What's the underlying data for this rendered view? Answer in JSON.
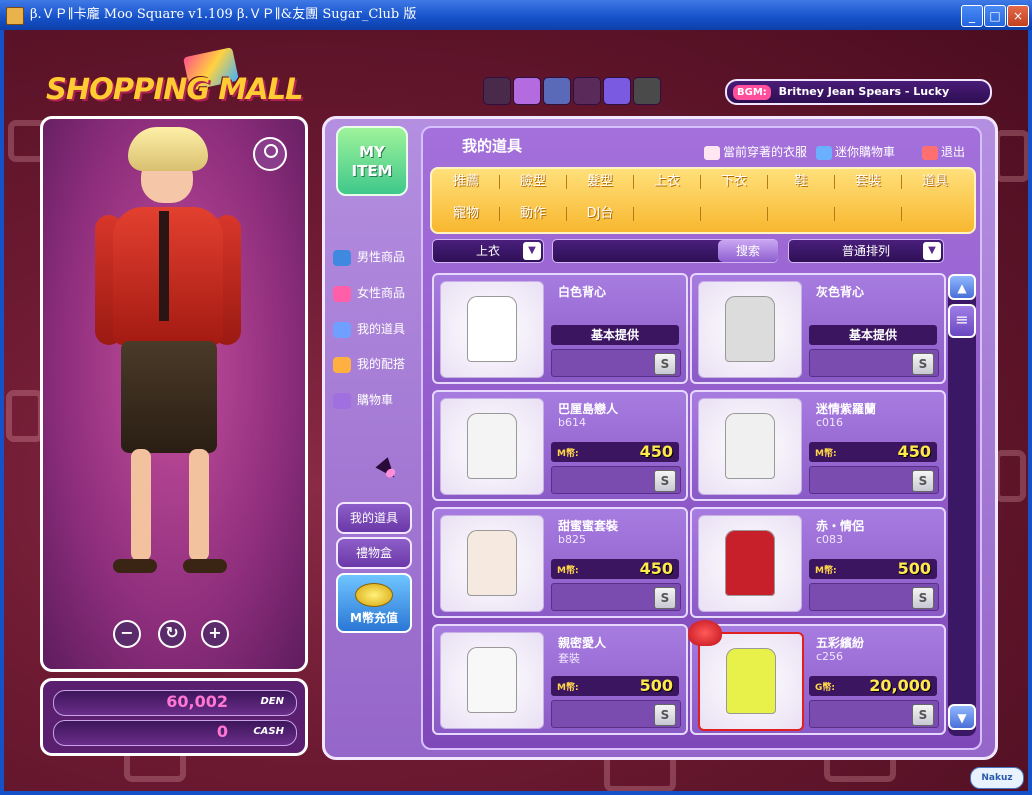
{
  "window": {
    "title": "β.ＶＰ∥卡龐 Moo Square v1.109 β.ＶＰ∥&友團 Sugar_Club 版",
    "min_label": "_",
    "max_label": "□",
    "close_label": "×"
  },
  "logo": {
    "text": "SHOPPING MALL"
  },
  "bgm": {
    "tag": "BGM:",
    "song": "Britney Jean Spears - Lucky"
  },
  "currency": {
    "den_value": "60,002",
    "den_unit": "DEN",
    "cash_value": "0",
    "cash_unit": "CASH"
  },
  "left_nav": {
    "myitem_label": "MY ITEM",
    "categories": [
      {
        "label": "男性商品"
      },
      {
        "label": "女性商品"
      },
      {
        "label": "我的道具"
      },
      {
        "label": "我的配搭"
      },
      {
        "label": "購物車"
      }
    ],
    "buttons": [
      {
        "label": "我的道具"
      },
      {
        "label": "禮物盒"
      }
    ],
    "charge_label": "M幣充值"
  },
  "panel": {
    "title": "我的道具",
    "current_outfit": "當前穿著的衣服",
    "mini_cart": "迷你購物車",
    "exit": "退出"
  },
  "tabs": {
    "row1": [
      "推薦",
      "臉型",
      "髮型",
      "上衣",
      "下衣",
      "鞋",
      "套裝",
      "道具"
    ],
    "row2": [
      "寵物",
      "動作",
      "DJ台"
    ],
    "active": "上衣"
  },
  "filter": {
    "category": "上衣",
    "search_label": "搜索",
    "sort": "普通排列",
    "dropdown_arrow": "▼"
  },
  "items": [
    {
      "name": "白色背心",
      "code": "",
      "price_type": "basic",
      "price_label": "基本提供",
      "price": "",
      "color": "#ffffff"
    },
    {
      "name": "灰色背心",
      "code": "",
      "price_type": "basic",
      "price_label": "基本提供",
      "price": "",
      "color": "#dcdcdc"
    },
    {
      "name": "巴厘島戀人",
      "code": "b614",
      "price_type": "M",
      "price_label": "M幣:",
      "price": "450",
      "color": "#f4f4f4"
    },
    {
      "name": "迷情紫羅蘭",
      "code": "c016",
      "price_type": "M",
      "price_label": "M幣:",
      "price": "450",
      "color": "#f0f0f0"
    },
    {
      "name": "甜蜜蜜套裝",
      "code": "b825",
      "price_type": "M",
      "price_label": "M幣:",
      "price": "450",
      "color": "#f6e9e0"
    },
    {
      "name": "赤・情侶",
      "code": "c083",
      "price_type": "M",
      "price_label": "M幣:",
      "price": "500",
      "color": "#c8202a"
    },
    {
      "name": "親密愛人",
      "code": "套裝",
      "price_type": "M",
      "price_label": "M幣:",
      "price": "500",
      "color": "#f8f8f8"
    },
    {
      "name": "五彩繽紛",
      "code": "c256",
      "price_type": "G",
      "price_label": "G幣:",
      "price": "20,000",
      "color": "#e8f04a"
    }
  ],
  "item_action_label": "S",
  "scroll": {
    "up": "▲",
    "thumb": "≡",
    "down": "▼"
  },
  "zoom": {
    "out": "−",
    "rotate": "↻",
    "in": "+"
  },
  "watermark": "Nakuz"
}
